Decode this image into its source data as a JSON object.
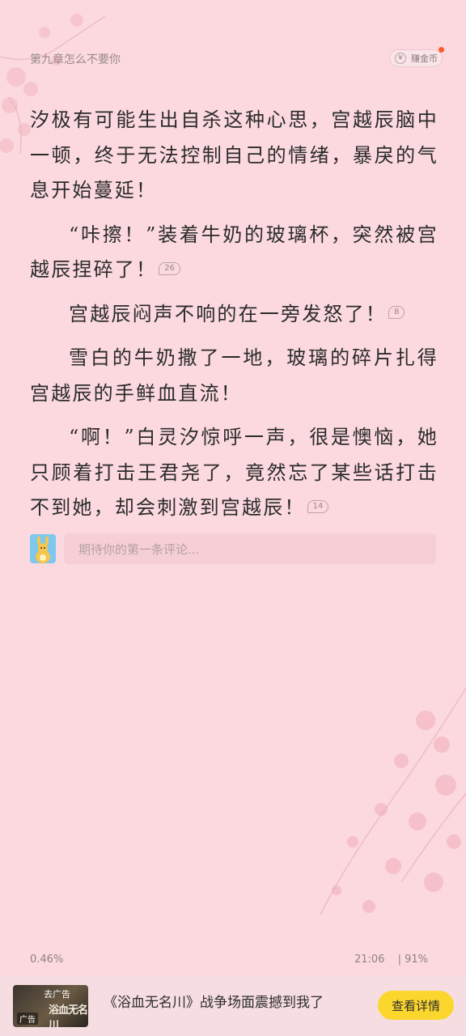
{
  "header": {
    "chapter_title": "第九章怎么不要你",
    "coin_button": {
      "icon": "yen-icon",
      "label": "赚金币",
      "symbol": "¥"
    }
  },
  "paragraphs": [
    {
      "text": "汐极有可能生出自杀这种心思，宫越辰脑中一顿，终于无法控制自己的情绪，暴戾的气息开始蔓延！",
      "comments": ""
    },
    {
      "text": "“咔擦！”装着牛奶的玻璃杯，突然被宫越辰捏碎了！",
      "comments": "26"
    },
    {
      "text": "宫越辰闷声不响的在一旁发怒了！",
      "comments": "8"
    },
    {
      "text": "雪白的牛奶撒了一地，玻璃的碎片扎得宫越辰的手鲜血直流！",
      "comments": ""
    },
    {
      "text": "“啊！”白灵汐惊呼一声，很是懊恼，她只顾着打击王君尧了，竟然忘了某些话打击不到她，却会刺激到宫越辰！",
      "comments": "14"
    }
  ],
  "comment_box": {
    "placeholder": "期待你的第一条评论..."
  },
  "status": {
    "progress": "0.46%",
    "time": "21:06",
    "battery": "| 91%"
  },
  "ad": {
    "thumb_tag": "去广告",
    "thumb_title": "浴血无名川",
    "thumb_label": "广告",
    "text": "《浴血无名川》战争场面震撼到我了",
    "button": "查看详情"
  },
  "colors": {
    "background": "#fbd9df",
    "accent_button": "#fbd62d",
    "notification_dot": "#ff5a2b"
  }
}
